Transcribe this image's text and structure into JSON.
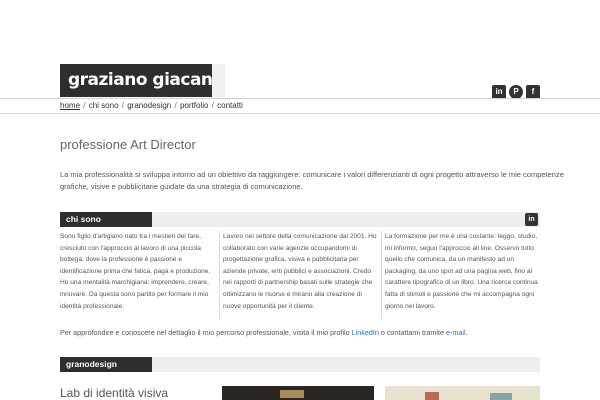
{
  "header": {
    "logo_text": "graziano giacani",
    "social": [
      {
        "icon": "linkedin-icon",
        "glyph": "in"
      },
      {
        "icon": "pinterest-icon",
        "glyph": "P"
      },
      {
        "icon": "facebook-icon",
        "glyph": "f"
      }
    ]
  },
  "nav": {
    "items": [
      "home",
      "chi sono",
      "granodesign",
      "portfolio",
      "contatti"
    ],
    "separator": "/"
  },
  "main": {
    "title": "professione Art Director",
    "intro": "La mia professionalità si sviluppa intorno ad un obiettivo da raggiungere: comunicare i valori differenzianti di ogni progetto attraverso le mie competenze grafiche, visive e pubblicitarie guidate da una strategia di comunicazione."
  },
  "chi_sono": {
    "tab": "chi sono",
    "col1": "Sono figlio d'artigiano nato tra i mestieri del fare, cresciuto con l'approccio al lavoro di una piccola bottega, dove la professione è passione e identificazione prima che fatica, paga e produzione. Ho una mentalità marchigiana: imprendere, creare, innovare. Da questa sono partito per formare il mio identità professionale.",
    "col2": "Lavoro nel settore della comunicazione dal 2001. Ho collaborato con varie agenzie occupandomi di progettazione grafica, visiva e pubblicitaria per aziende private, enti pubblici e associazioni. Credo nei rapporti di partnership basati sulle strategie che ottimizzano le risorse e mirano alla creazione di nuove opportunità per il cliente.",
    "col3": "La formazione per me è una costante: leggo, studio, mi informo, seguo l'approccio all line. Osservo tutto quello che comunica, da un manifesto ad un packaging, da uno spot ad una pagina web, fino al carattere tipografico di un libro. Una ricerca continua fatta di stimoli e passione che mi accompagna ogni giorno nel lavoro.",
    "more_text": "Per approfondire e conoscere nel dettaglio il mio percorso professionale, visita il mio profilo",
    "linkedin_link": "LinkedIn",
    "or_text": "o contattami tramite",
    "email_link": "e-mail",
    "end": "."
  },
  "granodesign": {
    "tab": "granodesign",
    "lab_title": "Lab di identità visiva"
  }
}
